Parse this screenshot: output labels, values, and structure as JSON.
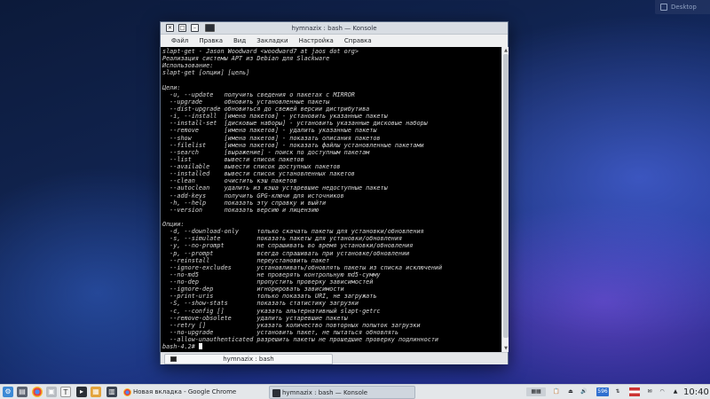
{
  "desktop": {
    "widget_label": "Desktop"
  },
  "window": {
    "title": "hymnazix : bash — Konsole",
    "menu": [
      "Файл",
      "Правка",
      "Вид",
      "Закладки",
      "Настройка",
      "Справка"
    ],
    "terminal_lines": [
      "slapt-get - Jason Woodward <woodward7 at jaos dot org>",
      "Реализация системы APT из Debian для Slackware",
      "Использование:",
      "slapt-get [опции] [цель]",
      "",
      "Цели:",
      "  -u, --update   получить сведения о пакетах с MIRROR",
      "  --upgrade      обновить установленные пакеты",
      "  --dist-upgrade обновиться до свежей версии дистрибутива",
      "  -i, --install  [имена пакетов] - установить указанные пакеты",
      "  --install-set  [дисковые наборы] - установить указанные дисковые наборы",
      "  --remove       [имена пакетов] - удалить указанные пакеты",
      "  --show         [имена пакетов] - показать описания пакетов",
      "  --filelist     [имена пакетов] - показать файлы установленные пакетами",
      "  --search       [выражение] - поиск по доступным пакетам",
      "  --list         вывести список пакетов",
      "  --available    вывести список доступных пакетов",
      "  --installed    вывести список установленных пакетов",
      "  --clean        очистить кэш пакетов",
      "  --autoclean    удалить из кэша устаревшие недоступные пакеты",
      "  --add-keys     получить GPG-ключи для источников",
      "  -h, --help     показать эту справку и выйти",
      "  --version      показать версию и лицензию",
      "",
      "Опции:",
      "  -d, --download-only     только скачать пакеты для установки/обновления",
      "  -s, --simulate          показать пакеты для установки/обновления",
      "  -y, --no-prompt         не спрашивать во время установки/обновления",
      "  -p, --prompt            всегда спрашивать при установке/обновлении",
      "  --reinstall             переустановить пакет",
      "  --ignore-excludes       устанавливать/обновлять пакеты из списка исключений",
      "  --no-md5                не проверять контрольную md5-сумму",
      "  --no-dep                пропустить проверку зависимостей",
      "  --ignore-dep            игнорировать зависимости",
      "  --print-uris            только показать URI, не загружать",
      "  -S, --show-stats        показать статистику загрузки",
      "  -c, --config []         указать альтернативный slapt-getrc",
      "  --remove-obsolete       удалить устаревшие пакеты",
      "  --retry []              указать количество повторных попыток загрузки",
      "  --no-upgrade            установить пакет, не пытаться обновлять",
      "  --allow-unauthenticated разрешить пакеты не прошедшие проверку подлинности"
    ],
    "prompt": "bash-4.2# ",
    "tab_label": "hymnazix : bash"
  },
  "taskbar": {
    "tasks": [
      {
        "label": "Новая вкладка - Google Chrome",
        "icon": "chrome-icon"
      },
      {
        "label": "hymnazix : bash — Konsole",
        "icon": "konsole-icon"
      }
    ],
    "tray_badge": "596",
    "clock": "10:40"
  },
  "colors": {
    "terminal_bg": "#000000",
    "terminal_fg": "#d8d8d8",
    "panel": "#e4e7ea"
  }
}
